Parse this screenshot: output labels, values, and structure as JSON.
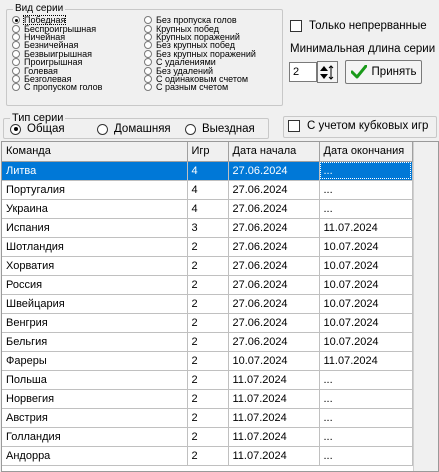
{
  "series_type_group": {
    "legend": "Вид серии",
    "left_options": [
      "Победная",
      "Беспроигрышная",
      "Ничейная",
      "Безничейная",
      "Безвыигрышная",
      "Проигрышная",
      "Голевая",
      "Безголевая",
      "С пропуском голов"
    ],
    "right_options": [
      "Без пропуска голов",
      "Крупных побед",
      "Крупных поражений",
      "Без крупных побед",
      "Без крупных поражений",
      "С удалениями",
      "Без удалений",
      "С одинаковым счетом",
      "С разным счетом"
    ],
    "selected": "Победная"
  },
  "options": {
    "only_continuous_label": "Только непрерванные",
    "min_length_label": "Минимальная длина серии",
    "min_length_value": "2",
    "apply_label": "Принять",
    "with_cup_games_label": "С учетом кубковых игр"
  },
  "game_type_group": {
    "legend": "Тип серии",
    "options": [
      "Общая",
      "Домашняя",
      "Выездная"
    ],
    "selected": "Общая"
  },
  "table": {
    "columns": [
      "Команда",
      "Игр",
      "Дата начала",
      "Дата окончания"
    ],
    "rows": [
      [
        "Литва",
        "4",
        "27.06.2024",
        "..."
      ],
      [
        "Португалия",
        "4",
        "27.06.2024",
        "..."
      ],
      [
        "Украина",
        "4",
        "27.06.2024",
        "..."
      ],
      [
        "Испания",
        "3",
        "27.06.2024",
        "11.07.2024"
      ],
      [
        "Шотландия",
        "2",
        "27.06.2024",
        "10.07.2024"
      ],
      [
        "Хорватия",
        "2",
        "27.06.2024",
        "10.07.2024"
      ],
      [
        "Россия",
        "2",
        "27.06.2024",
        "10.07.2024"
      ],
      [
        "Швейцария",
        "2",
        "27.06.2024",
        "10.07.2024"
      ],
      [
        "Венгрия",
        "2",
        "27.06.2024",
        "10.07.2024"
      ],
      [
        "Бельгия",
        "2",
        "27.06.2024",
        "10.07.2024"
      ],
      [
        "Фареры",
        "2",
        "10.07.2024",
        "11.07.2024"
      ],
      [
        "Польша",
        "2",
        "11.07.2024",
        "..."
      ],
      [
        "Норвегия",
        "2",
        "11.07.2024",
        "..."
      ],
      [
        "Австрия",
        "2",
        "11.07.2024",
        "..."
      ],
      [
        "Голландия",
        "2",
        "11.07.2024",
        "..."
      ],
      [
        "Андорра",
        "2",
        "11.07.2024",
        "..."
      ]
    ],
    "selected_row": 0
  },
  "colors": {
    "selection": "#0078d7",
    "apply_check": "#1a9a1a"
  }
}
